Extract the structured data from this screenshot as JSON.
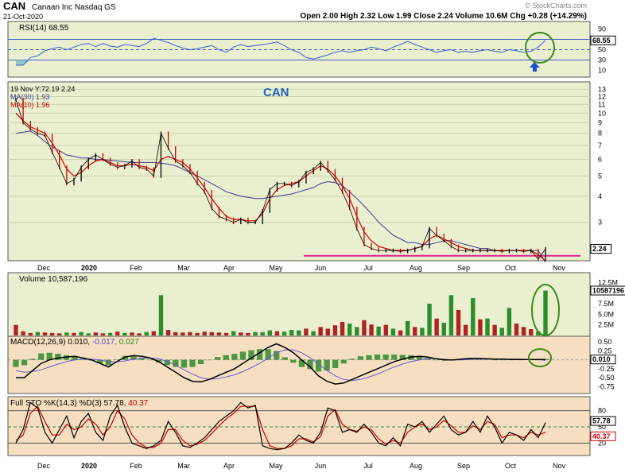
{
  "header": {
    "symbol": "CAN",
    "company": "Canaan Inc  Nasdaq GS",
    "date": "21-Oct-2020",
    "watermark": "© StockCharts.com",
    "ohlc_label": "Open 2.00  High 2.32  Low 1.99  Close 2.24  Volume 10.6M  Chg +0.28 (+14.29%)"
  },
  "chart_data": [
    {
      "type": "line",
      "panel": "rsi",
      "legend": "RSI(14) 68.55",
      "y_ticks": [
        "90",
        "70",
        "50",
        "30",
        "10"
      ],
      "ylim": [
        0,
        100
      ],
      "reference_lines": [
        70,
        50,
        30
      ],
      "last_value_label": "68.55",
      "series": [
        {
          "name": "RSI(14)",
          "color": "#3a5fcd",
          "values": [
            20,
            20,
            35,
            38,
            48,
            52,
            55,
            50,
            55,
            60,
            62,
            56,
            62,
            57,
            55,
            60,
            58,
            56,
            62,
            72,
            68,
            64,
            58,
            53,
            50,
            52,
            55,
            58,
            50,
            45,
            55,
            60,
            56,
            58,
            60,
            62,
            65,
            58,
            50,
            45,
            35,
            32,
            36,
            40,
            45,
            48,
            45,
            48,
            50,
            55,
            52,
            48,
            55,
            60,
            66,
            60,
            55,
            50,
            45,
            48,
            50,
            45,
            47,
            45,
            48,
            50,
            47,
            45,
            50,
            48,
            45,
            47,
            55,
            68
          ]
        }
      ]
    },
    {
      "type": "line",
      "panel": "price",
      "title": "CAN",
      "legend": [
        "19 Nov Y:72.19  2.24",
        "MA(30) 1.93",
        "MA(10) 1.96"
      ],
      "x_ticks": [
        "Dec",
        "2020",
        "Feb",
        "Mar",
        "Apr",
        "May",
        "Jun",
        "Jul",
        "Aug",
        "Sep",
        "Oct",
        "Nov"
      ],
      "y_ticks": [
        "13",
        "12",
        "11",
        "10",
        "9",
        "8",
        "7",
        "6",
        "5",
        "4",
        "3"
      ],
      "log_scale": true,
      "last_value_label": "2.24",
      "support_line": 2.15,
      "series": [
        {
          "name": "Price",
          "color": "#000000",
          "highlight": "#cc0000",
          "values": [
            11.6,
            9.0,
            8.4,
            8.0,
            7.8,
            6.5,
            5.5,
            4.6,
            4.8,
            5.5,
            6.0,
            6.3,
            6.0,
            5.7,
            5.5,
            5.6,
            5.9,
            5.5,
            5.4,
            5.0,
            8.0,
            6.8,
            5.9,
            5.6,
            5.2,
            4.6,
            4.2,
            3.5,
            3.2,
            3.1,
            3.0,
            3.1,
            3.0,
            3.0,
            3.4,
            4.3,
            4.6,
            4.6,
            4.5,
            4.7,
            5.2,
            5.4,
            5.8,
            5.3,
            4.8,
            4.2,
            3.5,
            2.8,
            2.35,
            2.25,
            2.2,
            2.2,
            2.2,
            2.18,
            2.2,
            2.25,
            2.3,
            2.8,
            2.6,
            2.45,
            2.3,
            2.2,
            2.2,
            2.2,
            2.2,
            2.2,
            2.2,
            2.18,
            2.2,
            2.2,
            2.18,
            2.2,
            2.0,
            2.24
          ]
        },
        {
          "name": "MA(30)",
          "color": "#3a3a8a",
          "values": [
            8.0,
            8.1,
            8.2,
            7.8,
            7.3,
            6.9,
            6.6,
            6.3,
            6.2,
            6.1,
            6.1,
            6.0,
            6.0,
            5.95,
            5.9,
            5.85,
            5.8,
            5.8,
            5.8,
            5.8,
            5.75,
            5.7,
            5.6,
            5.4,
            5.2,
            5.0,
            4.8,
            4.6,
            4.4,
            4.2,
            4.1,
            4.0,
            3.95,
            3.9,
            3.9,
            3.95,
            4.0,
            4.05,
            4.1,
            4.2,
            4.3,
            4.4,
            4.6,
            4.7,
            4.65,
            4.5,
            4.2,
            3.9,
            3.6,
            3.3,
            3.0,
            2.8,
            2.6,
            2.5,
            2.4,
            2.4,
            2.35,
            2.35,
            2.4,
            2.45,
            2.45,
            2.4,
            2.35,
            2.3,
            2.25,
            2.25,
            2.2,
            2.2,
            2.2,
            2.2,
            2.2,
            2.2,
            2.2,
            1.93
          ]
        },
        {
          "name": "MA(10)",
          "color": "#cc0000",
          "values": [
            10.0,
            9.2,
            8.6,
            8.3,
            8.0,
            7.2,
            6.3,
            5.4,
            5.0,
            5.2,
            5.6,
            5.9,
            6.0,
            5.8,
            5.6,
            5.6,
            5.7,
            5.6,
            5.5,
            5.3,
            6.0,
            6.2,
            6.0,
            5.8,
            5.4,
            4.9,
            4.4,
            3.9,
            3.5,
            3.2,
            3.1,
            3.1,
            3.05,
            3.05,
            3.3,
            3.9,
            4.3,
            4.5,
            4.6,
            4.7,
            5.0,
            5.3,
            5.6,
            5.4,
            5.0,
            4.5,
            3.9,
            3.2,
            2.7,
            2.45,
            2.3,
            2.25,
            2.2,
            2.2,
            2.2,
            2.25,
            2.3,
            2.5,
            2.6,
            2.5,
            2.4,
            2.3,
            2.25,
            2.2,
            2.2,
            2.2,
            2.2,
            2.2,
            2.2,
            2.2,
            2.2,
            2.2,
            2.1,
            1.96
          ]
        }
      ]
    },
    {
      "type": "bar",
      "panel": "volume",
      "legend": "Volume 10,587,196",
      "y_ticks": [
        "12.5M",
        "10.0M",
        "7.5M",
        "5.0M",
        "2.5M"
      ],
      "ylim": [
        0,
        13.5
      ],
      "last_value_label": "10587196",
      "up_color": "#2e8b2e",
      "down_color": "#b22222",
      "values": [
        2.5,
        1.0,
        0.6,
        0.8,
        0.7,
        0.6,
        0.5,
        0.7,
        0.6,
        0.8,
        0.5,
        0.7,
        0.5,
        0.6,
        0.9,
        0.6,
        0.7,
        0.5,
        0.8,
        1.0,
        9.5,
        1.3,
        0.8,
        0.7,
        0.8,
        0.6,
        0.9,
        0.8,
        0.7,
        0.6,
        1.0,
        0.7,
        0.6,
        0.8,
        0.8,
        1.2,
        1.0,
        0.9,
        1.3,
        1.2,
        1.6,
        1.0,
        2.0,
        1.6,
        2.4,
        3.2,
        2.8,
        2.0,
        3.6,
        2.6,
        2.1,
        2.5,
        1.6,
        1.2,
        3.4,
        2.0,
        1.8,
        7.5,
        4.0,
        3.0,
        9.5,
        6.0,
        2.5,
        8.8,
        3.8,
        4.0,
        2.5,
        1.8,
        6.5,
        2.8,
        2.0,
        1.5,
        1.0,
        10.59
      ],
      "up": [
        false,
        false,
        false,
        true,
        false,
        false,
        false,
        true,
        false,
        true,
        true,
        false,
        false,
        true,
        false,
        true,
        false,
        false,
        true,
        false,
        true,
        false,
        false,
        false,
        false,
        false,
        false,
        false,
        false,
        false,
        true,
        false,
        false,
        true,
        true,
        true,
        false,
        true,
        true,
        true,
        false,
        true,
        false,
        false,
        false,
        false,
        true,
        true,
        false,
        false,
        true,
        false,
        true,
        false,
        true,
        false,
        true,
        true,
        false,
        true,
        true,
        false,
        false,
        true,
        false,
        true,
        false,
        true,
        true,
        false,
        false,
        false,
        true,
        true
      ]
    },
    {
      "type": "line",
      "panel": "macd",
      "legend": [
        "MACD(12,26,9)",
        "0.010,",
        "-0.017,",
        "0.027"
      ],
      "legend_colors": [
        "#000000",
        "#000000",
        "#5a4fcf",
        "#2e8b2e"
      ],
      "y_ticks": [
        "0.50",
        "0.25",
        "0.00",
        "-0.25",
        "-0.50",
        "-0.75"
      ],
      "ylim": [
        -0.9,
        0.55
      ],
      "last_value_label": "0.010",
      "series": [
        {
          "name": "MACD",
          "color": "#000000",
          "values": [
            -0.5,
            -0.5,
            -0.3,
            -0.1,
            0.0,
            0.05,
            0.08,
            0.1,
            0.05,
            0.0,
            -0.1,
            -0.2,
            -0.05,
            0.08,
            0.12,
            0.1,
            0.05,
            -0.05,
            -0.2,
            -0.35,
            -0.5,
            -0.6,
            -0.62,
            -0.55,
            -0.45,
            -0.35,
            -0.25,
            -0.1,
            0.05,
            0.2,
            0.35,
            0.45,
            0.35,
            0.2,
            0.0,
            -0.2,
            -0.45,
            -0.6,
            -0.68,
            -0.65,
            -0.55,
            -0.45,
            -0.35,
            -0.25,
            -0.15,
            -0.05,
            0.02,
            0.08,
            0.1,
            0.08,
            0.03,
            0.0,
            0.0,
            0.02,
            0.04,
            0.04,
            0.03,
            0.02,
            0.02,
            0.01,
            0.01,
            0.01,
            0.01,
            0.01
          ]
        },
        {
          "name": "Signal",
          "color": "#6a5acd",
          "values": [
            -0.3,
            -0.35,
            -0.33,
            -0.28,
            -0.2,
            -0.12,
            -0.05,
            0.0,
            0.02,
            0.02,
            0.0,
            -0.05,
            -0.06,
            -0.03,
            0.02,
            0.05,
            0.05,
            0.03,
            -0.05,
            -0.15,
            -0.28,
            -0.4,
            -0.5,
            -0.54,
            -0.53,
            -0.48,
            -0.42,
            -0.33,
            -0.22,
            -0.1,
            0.05,
            0.2,
            0.28,
            0.28,
            0.2,
            0.06,
            -0.12,
            -0.3,
            -0.45,
            -0.55,
            -0.58,
            -0.55,
            -0.48,
            -0.4,
            -0.3,
            -0.2,
            -0.12,
            -0.05,
            0.0,
            0.03,
            0.03,
            0.02,
            0.0,
            0.0,
            0.01,
            0.02,
            0.02,
            0.02,
            0.02,
            0.02,
            0.02,
            0.015,
            0.01,
            -0.017
          ]
        },
        {
          "name": "Histogram",
          "color": "#2e8b2e",
          "values": [
            -0.2,
            -0.15,
            0.03,
            0.18,
            0.2,
            0.17,
            0.13,
            0.1,
            0.03,
            -0.02,
            -0.1,
            -0.15,
            0.01,
            0.11,
            0.1,
            0.05,
            0.0,
            -0.08,
            -0.15,
            -0.2,
            -0.22,
            -0.2,
            -0.12,
            -0.01,
            0.08,
            0.13,
            0.17,
            0.23,
            0.27,
            0.3,
            0.3,
            0.25,
            0.07,
            -0.08,
            -0.2,
            -0.26,
            -0.33,
            -0.3,
            -0.23,
            -0.1,
            0.03,
            0.1,
            0.13,
            0.15,
            0.15,
            0.15,
            0.14,
            0.13,
            0.1,
            0.05,
            0.0,
            -0.02,
            0.0,
            0.02,
            0.03,
            0.02,
            0.01,
            0.0,
            0.0,
            -0.01,
            -0.01,
            -0.005,
            0.0,
            0.027
          ]
        }
      ]
    },
    {
      "type": "line",
      "panel": "sto",
      "legend": [
        "Full STO %K(14,3) %D(3)",
        "57.78,",
        "40.37"
      ],
      "legend_colors": [
        "#000000",
        "#000000",
        "#cc0000"
      ],
      "y_ticks": [
        "80",
        "50",
        "20"
      ],
      "ylim": [
        0,
        100
      ],
      "reference_lines": [
        80,
        50,
        20
      ],
      "last_value_labels": [
        "57.78",
        "40.37"
      ],
      "x_ticks": [
        "Dec",
        "2020",
        "Feb",
        "Mar",
        "Apr",
        "May",
        "Jun",
        "Jul",
        "Aug",
        "Sep",
        "Oct",
        "Nov"
      ],
      "series": [
        {
          "name": "%K",
          "color": "#000000",
          "values": [
            20,
            45,
            95,
            85,
            40,
            20,
            45,
            70,
            30,
            60,
            75,
            40,
            25,
            70,
            90,
            50,
            20,
            15,
            10,
            15,
            25,
            60,
            40,
            15,
            12,
            20,
            30,
            45,
            60,
            70,
            80,
            95,
            85,
            90,
            15,
            10,
            8,
            10,
            20,
            35,
            25,
            20,
            40,
            85,
            80,
            40,
            45,
            40,
            55,
            40,
            20,
            15,
            30,
            15,
            55,
            50,
            60,
            40,
            55,
            70,
            45,
            35,
            40,
            60,
            40,
            70,
            50,
            20,
            40,
            35,
            25,
            45,
            30,
            58
          ]
        },
        {
          "name": "%D",
          "color": "#cc0000",
          "values": [
            25,
            35,
            75,
            88,
            60,
            35,
            35,
            55,
            45,
            50,
            65,
            55,
            35,
            50,
            80,
            65,
            35,
            20,
            12,
            12,
            20,
            45,
            45,
            25,
            15,
            18,
            25,
            38,
            52,
            65,
            75,
            88,
            88,
            88,
            45,
            15,
            10,
            10,
            15,
            28,
            28,
            22,
            32,
            70,
            82,
            55,
            45,
            42,
            50,
            45,
            28,
            18,
            25,
            20,
            40,
            50,
            55,
            45,
            50,
            62,
            52,
            40,
            40,
            52,
            45,
            60,
            55,
            30,
            35,
            35,
            30,
            40,
            35,
            40
          ]
        }
      ]
    }
  ]
}
